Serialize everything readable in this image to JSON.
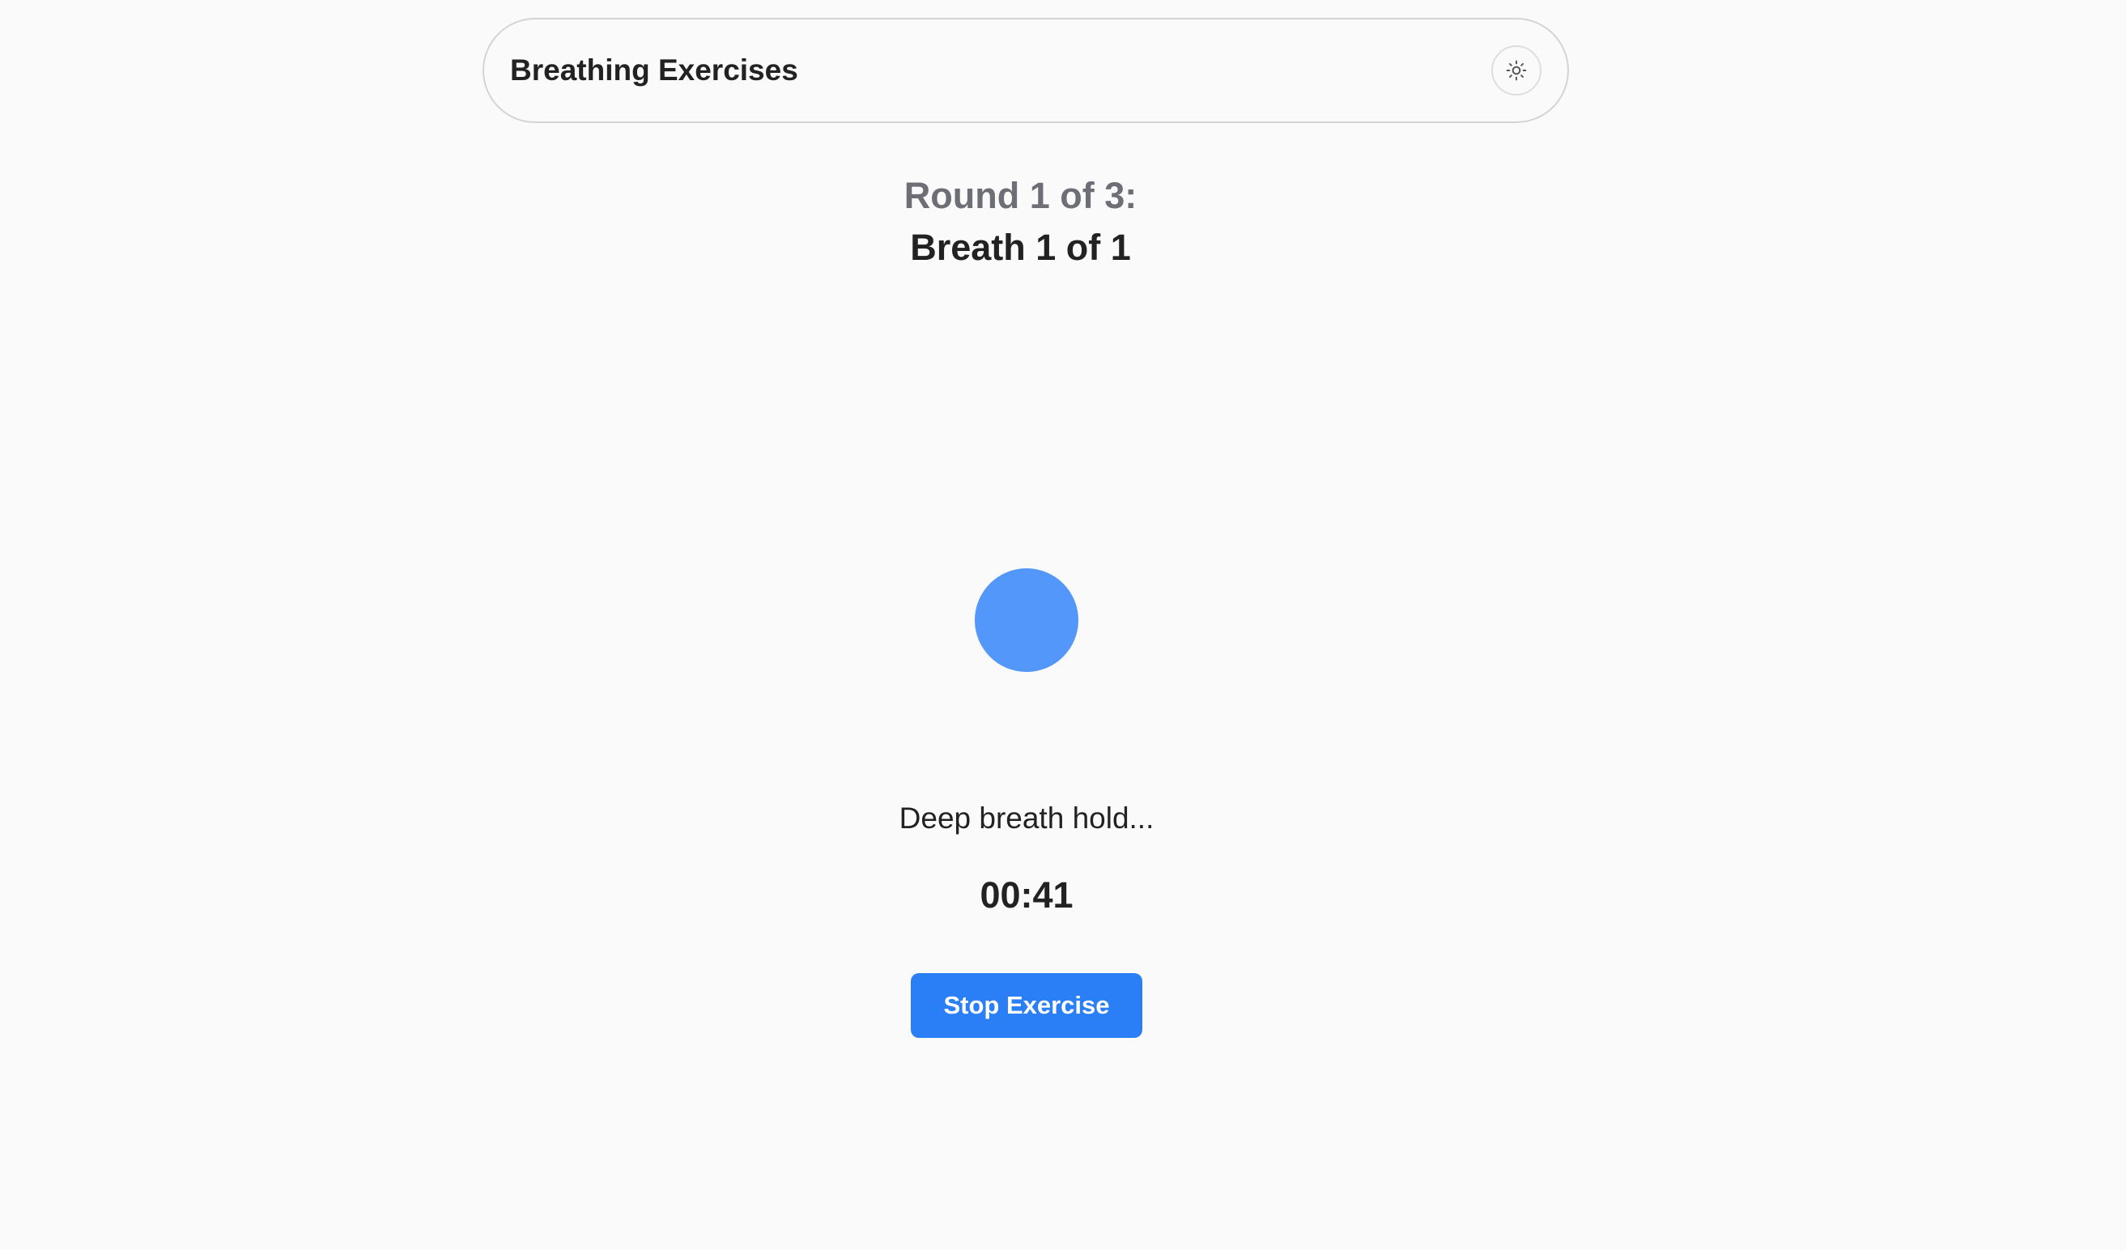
{
  "header": {
    "title": "Breathing Exercises",
    "theme_toggle_icon": "sun-icon"
  },
  "session": {
    "round_label": "Round 1 of 3:",
    "breath_label": "Breath 1 of 1",
    "instruction": "Deep breath hold...",
    "timer": "00:41",
    "stop_label": "Stop Exercise"
  },
  "colors": {
    "background": "#fafafa",
    "accent": "#2b7ff6",
    "circle": "#5397fa",
    "muted_text": "#6e6e76",
    "text": "#222222"
  }
}
